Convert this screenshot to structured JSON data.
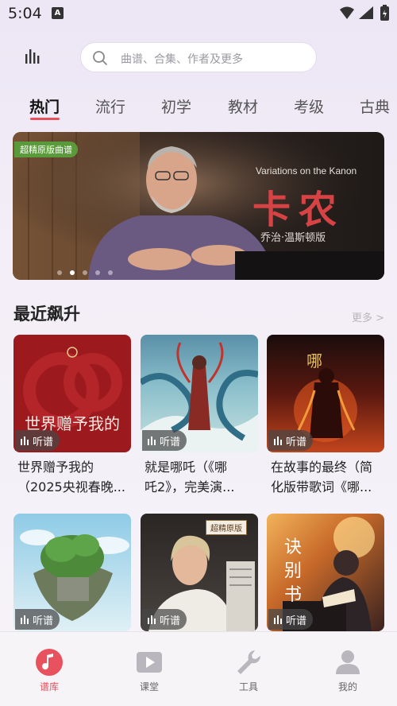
{
  "status": {
    "time": "5:04"
  },
  "search": {
    "placeholder": "曲谱、合集、作者及更多"
  },
  "tabs": [
    "热门",
    "流行",
    "初学",
    "教材",
    "考级",
    "古典"
  ],
  "banner": {
    "badge": "超精原版曲谱",
    "subtitle": "Variations on the Kanon",
    "title": "卡农",
    "caption": "乔治·温斯顿版"
  },
  "section": {
    "title": "最近飙升",
    "more": "更多 >"
  },
  "cards": [
    {
      "title_line1": "世界赠予我的",
      "title_line2": "（2025央视春晚...",
      "listen": "听谱",
      "cover_text": "世界赠予我的"
    },
    {
      "title_line1": "就是哪吒（《哪",
      "title_line2": "吒2》，完美演...",
      "listen": "听谱"
    },
    {
      "title_line1": "在故事的最终（简",
      "title_line2": "化版带歌词《哪...",
      "listen": "听谱"
    },
    {
      "listen": "听谱"
    },
    {
      "listen": "听谱",
      "badge": "超精原版"
    },
    {
      "listen": "听谱",
      "cover_text": "诀别书"
    }
  ],
  "nav": [
    {
      "label": "谱库",
      "icon": "music-note-icon",
      "active": true
    },
    {
      "label": "课堂",
      "icon": "play-icon"
    },
    {
      "label": "工具",
      "icon": "wrench-icon"
    },
    {
      "label": "我的",
      "icon": "person-icon"
    }
  ],
  "colors": {
    "accent": "#e8515e"
  }
}
